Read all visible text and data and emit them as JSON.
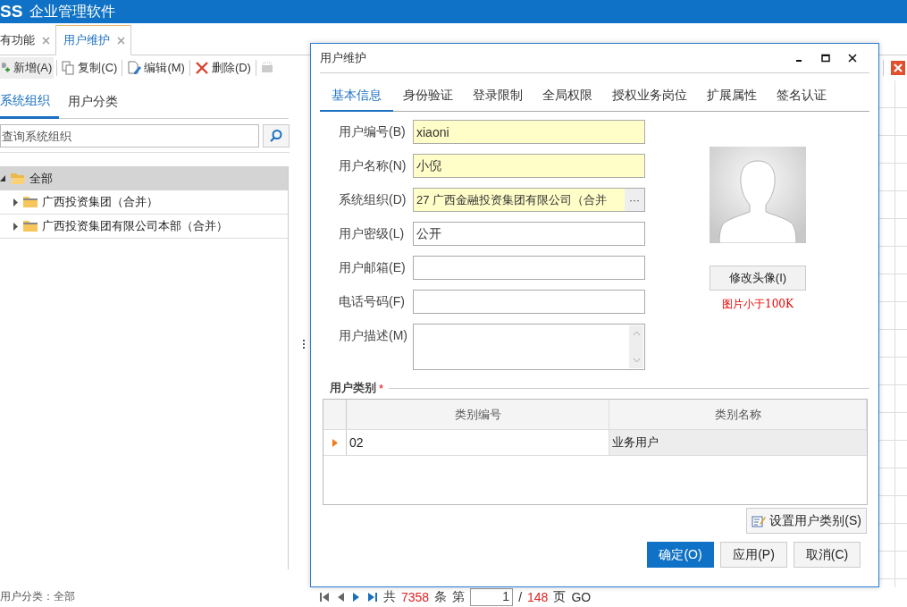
{
  "app": {
    "logo": "SS",
    "title": "企业管理软件"
  },
  "tabs": [
    {
      "label": "有功能",
      "selected": false
    },
    {
      "label": "用户维护",
      "selected": true
    }
  ],
  "toolbar": [
    {
      "label": "新增(A)",
      "kind": "add"
    },
    {
      "label": "复制(C)",
      "kind": "copy"
    },
    {
      "label": "编辑(M)",
      "kind": "edit"
    },
    {
      "label": "删除(D)",
      "kind": "delete"
    },
    {
      "kind": "print"
    }
  ],
  "left_tabs": [
    {
      "label": "系统组织",
      "selected": true
    },
    {
      "label": "用户分类",
      "selected": false
    }
  ],
  "search": {
    "placeholder": "查询系统组织"
  },
  "tree": [
    {
      "label": "全部",
      "expanded": true,
      "selected": true,
      "children": [
        {
          "label": "广西投资集团（合并）",
          "expanded": false,
          "selected": false
        },
        {
          "label": "广西投资集团有限公司本部（合并）",
          "expanded": false,
          "selected": false
        }
      ]
    }
  ],
  "status_bar": "用户分类：全部",
  "pager": {
    "prefix": "共",
    "total": "7358",
    "unit": "条",
    "page_prefix": "第",
    "page": "1",
    "slash": "/",
    "pages": "148",
    "pages_unit": "页",
    "go": "GO"
  },
  "dialog": {
    "title": "用户维护",
    "tabs": [
      {
        "label": "基本信息",
        "selected": true
      },
      {
        "label": "身份验证",
        "selected": false
      },
      {
        "label": "登录限制",
        "selected": false
      },
      {
        "label": "全局权限",
        "selected": false
      },
      {
        "label": "授权业务岗位",
        "selected": false
      },
      {
        "label": "扩展属性",
        "selected": false
      },
      {
        "label": "签名认证",
        "selected": false
      }
    ],
    "fields": [
      {
        "label": "用户编号(B)",
        "value": "xiaoni",
        "kind": "text",
        "required": true
      },
      {
        "label": "用户名称(N)",
        "value": "小倪",
        "kind": "text",
        "required": true
      },
      {
        "label": "系统组织(D)",
        "value": "27 广西金融投资集团有限公司（合并",
        "kind": "picker",
        "required": true,
        "button": "···"
      },
      {
        "label": "用户密级(L)",
        "value": "公开",
        "kind": "text",
        "required": false
      },
      {
        "label": "用户邮箱(E)",
        "kind": "text",
        "required": false
      },
      {
        "label": "电话号码(F)",
        "kind": "text",
        "required": false
      },
      {
        "label": "用户描述(M)",
        "kind": "textarea",
        "required": false
      }
    ],
    "avatar_button": "修改头像(I)",
    "avatar_note": "图片小于100K",
    "category": {
      "title": "用户类别",
      "required_mark": "*",
      "columns": [
        "类别编号",
        "类别名称"
      ],
      "rows": [
        {
          "cells": [
            "02",
            "业务用户"
          ],
          "selected": true
        }
      ]
    },
    "set_button": "设置用户类别(S)",
    "buttons": [
      {
        "label": "确定(O)",
        "primary": true
      },
      {
        "label": "应用(P)",
        "primary": false
      },
      {
        "label": "取消(C)",
        "primary": false
      }
    ]
  }
}
